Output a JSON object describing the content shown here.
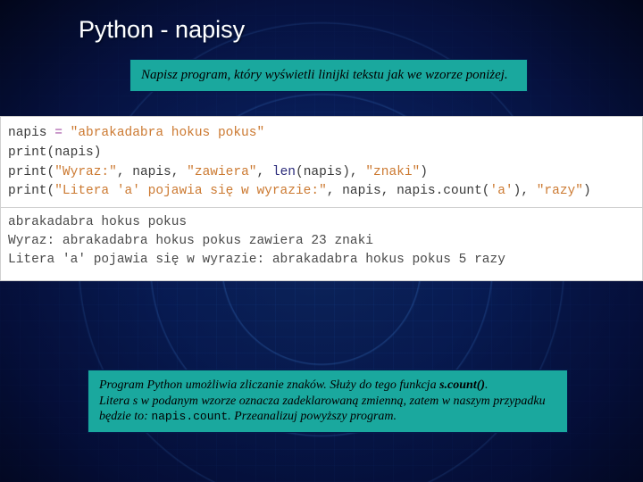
{
  "title": "Python - napisy",
  "intro": "Napisz program, który wyświetli linijki tekstu jak we wzorze poniżej.",
  "code": {
    "l1a": "napis ",
    "l1b": "=",
    "l1c": " \"abrakadabra hokus pokus\"",
    "l2a": "print",
    "l2b": "(napis)",
    "l3a": "print",
    "l3b": "(",
    "l3c": "\"Wyraz:\"",
    "l3d": ", napis, ",
    "l3e": "\"zawiera\"",
    "l3f": ", ",
    "l3g": "len",
    "l3h": "(napis), ",
    "l3i": "\"znaki\"",
    "l3j": ")",
    "l4a": "print",
    "l4b": "(",
    "l4c": "\"Litera 'a' pojawia się w wyrazie:\"",
    "l4d": ", napis, napis.count(",
    "l4e": "'a'",
    "l4f": "), ",
    "l4g": "\"razy\"",
    "l4h": ")"
  },
  "output": {
    "l1": "abrakadabra hokus pokus",
    "l2": "Wyraz: abrakadabra hokus pokus zawiera 23 znaki",
    "l3": "Litera 'a' pojawia się w wyrazie: abrakadabra hokus pokus 5 razy"
  },
  "explain": {
    "p1a": "Program Python umożliwia zliczanie znaków. Służy do tego funkcja ",
    "p1b": "s.count()",
    "p1c": ".",
    "p2a": "Litera s w podanym wzorze oznacza zadeklarowaną zmienną, zatem w naszym przypadku będzie to: ",
    "p2b": "napis.count",
    "p2c": ". Przeanalizuj powyższy program."
  }
}
